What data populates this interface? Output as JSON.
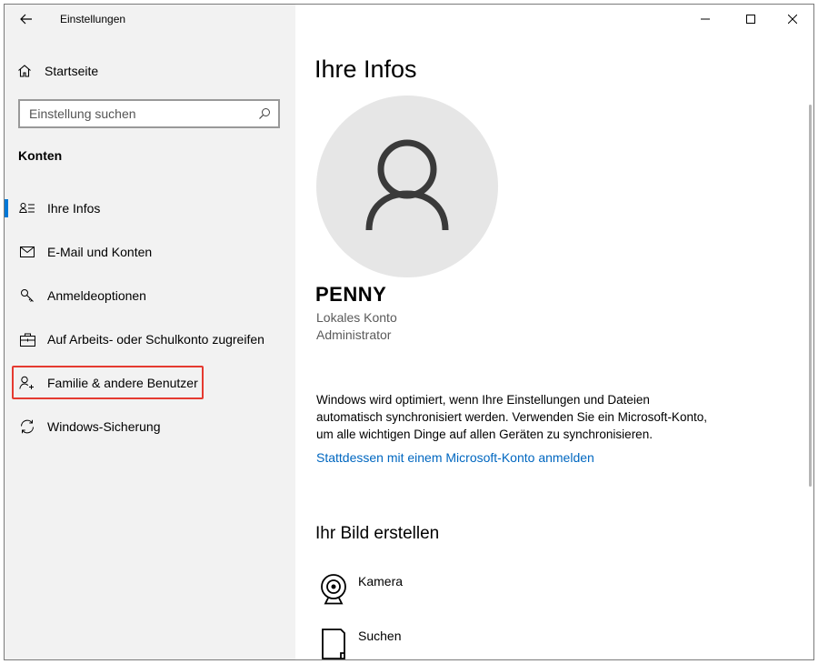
{
  "app": {
    "title": "Einstellungen"
  },
  "sidebar": {
    "home_label": "Startseite",
    "search_placeholder": "Einstellung suchen",
    "section_label": "Konten",
    "items": [
      {
        "label": "Ihre Infos",
        "icon": "person-info-icon",
        "active": true
      },
      {
        "label": "E-Mail und Konten",
        "icon": "mail-icon"
      },
      {
        "label": "Anmeldeoptionen",
        "icon": "key-icon"
      },
      {
        "label": "Auf Arbeits- oder Schulkonto zugreifen",
        "icon": "briefcase-icon"
      },
      {
        "label": "Familie & andere Benutzer",
        "icon": "add-person-icon",
        "highlighted": true
      },
      {
        "label": "Windows-Sicherung",
        "icon": "sync-icon"
      }
    ]
  },
  "main": {
    "title": "Ihre Infos",
    "user_name": "PENNY",
    "account_type": "Lokales Konto",
    "role": "Administrator",
    "sync_text": "Windows wird optimiert, wenn Ihre Einstellungen und Dateien automatisch synchronisiert werden. Verwenden Sie ein Microsoft-Konto, um alle wichtigen Dinge auf allen Geräten zu synchronisieren.",
    "link": "Stattdessen mit einem Microsoft-Konto anmelden",
    "picture_heading": "Ihr Bild erstellen",
    "picture_options": [
      {
        "label": "Kamera",
        "icon": "camera-icon"
      },
      {
        "label": "Suchen",
        "icon": "file-icon"
      }
    ]
  },
  "colors": {
    "accent": "#0078d7",
    "link": "#0067c0",
    "highlight": "#e53a30",
    "sidebar_bg": "#f2f2f2"
  }
}
